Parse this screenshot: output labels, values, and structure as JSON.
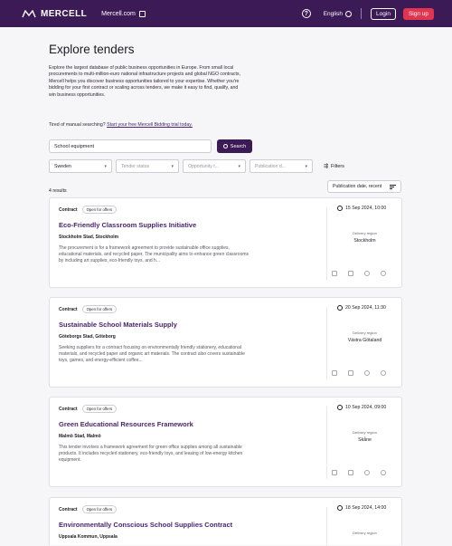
{
  "header": {
    "logo_text": "MERCELL",
    "site_link": "Mercell.com",
    "language": "English",
    "login_label": "Login",
    "signup_label": "Sign up"
  },
  "page": {
    "title": "Explore tenders",
    "intro": "Explore the largest database of public business opportunities in Europe. From small local procurements to multi-million-euro national infrastructure projects and global NGO contracts, Mercell helps you discover business opportunities tailored to your expertise. Whether you're bidding for your first contract or scaling across tenders, we make it easy to find, qualify, and win business opportunities.",
    "cta_prefix": "Tired of manual searching?",
    "cta_link": "Start your free Mercell Bidding trial today."
  },
  "search": {
    "value": "School equipment",
    "button_label": "Search"
  },
  "filters": {
    "country": "Sweden",
    "tender_status_placeholder": "Tender status",
    "opportunity_placeholder": "Opportunity t...",
    "publication_placeholder": "Publication d...",
    "all_filters_label": "Filters"
  },
  "results": {
    "count_label": "4 results",
    "sort_label": "Publication date, recent"
  },
  "cards": [
    {
      "type": "Contract",
      "status": "Open for offers",
      "title": "Eco-Friendly Classroom Supplies Initiative",
      "buyer": "Stockholm Stad, Stockholm",
      "description": "The procurement is for a framework agreement to provide sustainable office supplies, educational materials, and recycled paper. The municipality aims to enhance green classrooms by including art supplies, eco-friendly toys, and h...",
      "date": "15 Sep 2024, 10:00",
      "region_label": "Delivery region",
      "region": "Stockholm"
    },
    {
      "type": "Contract",
      "status": "Open for offers",
      "title": "Sustainable School Materials Supply",
      "buyer": "Göteborgs Stad, Göteborg",
      "description": "Seeking suppliers for a contract focusing on environmentally friendly stationery, educational materials, and recycled paper and organic art materials. The contract also covers sustainable toys, games, and energy-efficient coffee...",
      "date": "20 Sep 2024, 11:30",
      "region_label": "Delivery region",
      "region": "Västra Götaland"
    },
    {
      "type": "Contract",
      "status": "Open for offers",
      "title": "Green Educational Resources Framework",
      "buyer": "Malmö Stad, Malmö",
      "description": "This tender involves a framework agreement for green office supplies among all sustainable products. It includes recycled stationery, eco-friendly toys, and leasing of low-energy kitchen equipment.",
      "date": "10 Sep 2024, 09:00",
      "region_label": "Delivery region",
      "region": "Skåne"
    },
    {
      "type": "Contract",
      "status": "Open for offers",
      "title": "Environmentally Conscious School Supplies Contract",
      "buyer": "Uppsala Kommun, Uppsala",
      "description": "",
      "date": "18 Sep 2024, 14:00",
      "region_label": "Delivery region",
      "region": ""
    }
  ]
}
